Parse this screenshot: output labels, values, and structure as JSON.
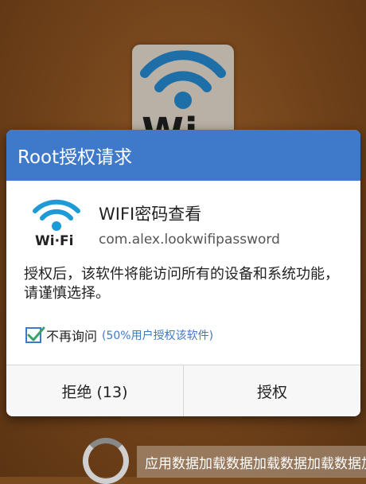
{
  "background": {
    "tile_text": "Wi-Fi"
  },
  "dialog": {
    "title": "Root授权请求",
    "app": {
      "icon_label": "Wi·Fi",
      "name": "WIFI密码查看",
      "package": "com.alex.lookwifipassword"
    },
    "warning": "授权后，该软件将能访问所有的设备和系统功能，请谨慎选择。",
    "remember": {
      "checked": true,
      "label": "不再询问",
      "hint": "(50%用户授权该软件)"
    },
    "buttons": {
      "deny": "拒绝 (13)",
      "allow": "授权"
    }
  },
  "loading": {
    "text": "应用数据加载数据加载数据加载数据加"
  },
  "colors": {
    "header": "#3f79c9",
    "wifi_icon": "#1e9ad6",
    "background": "#7a4a1f"
  }
}
